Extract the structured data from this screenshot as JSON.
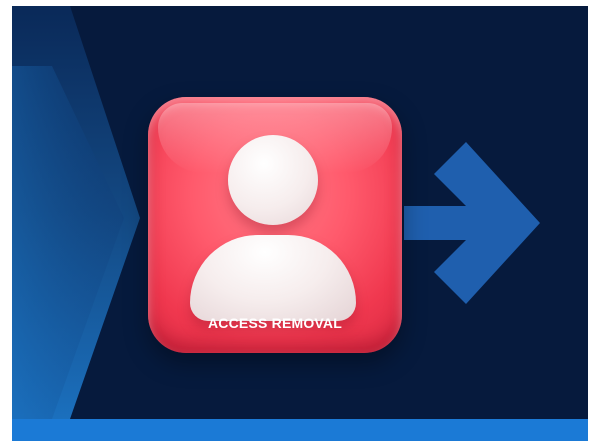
{
  "graphic": {
    "label": "ACCESS REMOVAL"
  },
  "icons": {
    "user": "user-icon",
    "arrow": "arrow-right-icon"
  },
  "colors": {
    "background": "#061a3d",
    "chevron": "#1b7ad6",
    "arrow": "#1f5fae",
    "card": "#f0384f",
    "bottom_strip": "#1b7ad6"
  }
}
